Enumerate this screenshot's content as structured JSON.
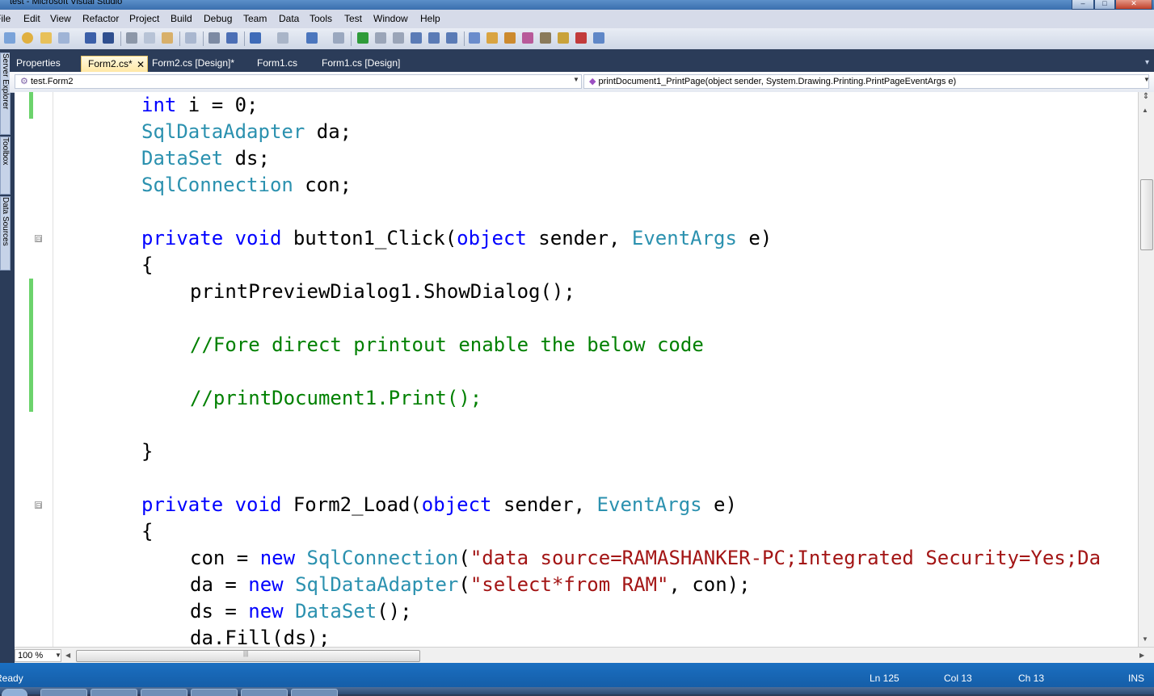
{
  "window": {
    "title": "test - Microsoft Visual Studio",
    "controls": [
      "–",
      "□",
      "✕"
    ]
  },
  "menu": [
    "File",
    "Edit",
    "View",
    "Refactor",
    "Project",
    "Build",
    "Debug",
    "Team",
    "Data",
    "Tools",
    "Test",
    "Window",
    "Help"
  ],
  "side_panels": [
    "Server Explorer",
    "Toolbox",
    "Data Sources"
  ],
  "tabs": [
    {
      "label": "Properties",
      "active": false
    },
    {
      "label": "Form2.cs*",
      "active": true,
      "close": "✕"
    },
    {
      "label": "Form2.cs [Design]*",
      "active": false
    },
    {
      "label": "Form1.cs",
      "active": false
    },
    {
      "label": "Form1.cs [Design]",
      "active": false
    }
  ],
  "navbar": {
    "class_selector": "test.Form2",
    "member_selector": "printDocument1_PrintPage(object sender, System.Drawing.Printing.PrintPageEventArgs e)"
  },
  "code_lines": [
    "int i = 0;",
    "SqlDataAdapter da;",
    "DataSet ds;",
    "SqlConnection con;",
    "",
    "private void button1_Click(object sender, EventArgs e)",
    "{",
    "printPreviewDialog1.ShowDialog();",
    "",
    "//Fore direct printout enable the below code",
    "",
    "//printDocument1.Print();",
    "",
    "}",
    "",
    "private void Form2_Load(object sender, EventArgs e)",
    "{",
    "con = new SqlConnection(\"data source=RAMASHANKER-PC;Integrated Security=Yes;Da",
    "da = new SqlDataAdapter(\"select*from RAM\", con);",
    "ds = new DataSet();",
    "da.Fill(ds);"
  ],
  "outline_markers": [
    "⊟",
    "⊟"
  ],
  "scroll_grip": "|||",
  "zoom": "100 %",
  "status": {
    "left": "Ready",
    "line": "Ln 125",
    "col": "Col 13",
    "ch": "Ch 13",
    "mode": "INS"
  },
  "colors": {
    "keyword": "#0000ff",
    "type": "#2b91af",
    "comment": "#008000",
    "string": "#a31515",
    "chrome": "#2b3c59",
    "status_bar": "#1b6fc1"
  }
}
